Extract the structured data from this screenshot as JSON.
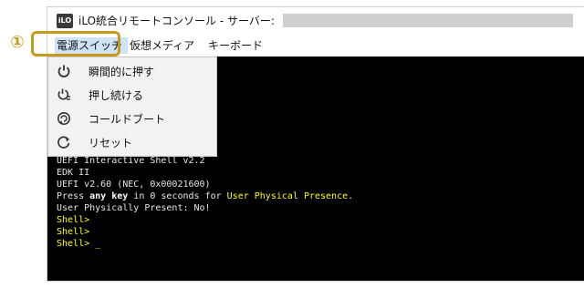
{
  "window": {
    "title": "iLO統合リモートコンソール - サーバー:",
    "icon_text": "iLO"
  },
  "menubar": {
    "items": [
      {
        "label": "電源スイッチ"
      },
      {
        "label": "仮想メディア"
      },
      {
        "label": "キーボード"
      }
    ]
  },
  "power_menu": {
    "items": [
      {
        "label": "瞬間的に押す",
        "icon": "power-icon"
      },
      {
        "label": "押し続ける",
        "icon": "power-hold-icon"
      },
      {
        "label": "コールドブート",
        "icon": "cold-boot-icon"
      },
      {
        "label": "リセット",
        "icon": "reset-icon"
      }
    ]
  },
  "console": {
    "line1": "UEFI Interactive Shell v2.2",
    "line2": "EDK II",
    "line3": "UEFI v2.60 (NEC, 0x00021600)",
    "line4_pre": "Press ",
    "line4_key": "any key",
    "line4_mid": " in 0 seconds for ",
    "line4_hl": "User Physical Presence",
    "line4_end": ".",
    "line5": "User Physically Present: No!",
    "prompt1": "Shell>",
    "prompt2": "Shell>",
    "prompt3": "Shell> _"
  },
  "annotation": {
    "marker": "①"
  },
  "colors": {
    "highlight": "#c89a1a",
    "console_bg": "#000000",
    "console_yellow": "#ffff00",
    "menu_active": "#cfe3f7"
  }
}
